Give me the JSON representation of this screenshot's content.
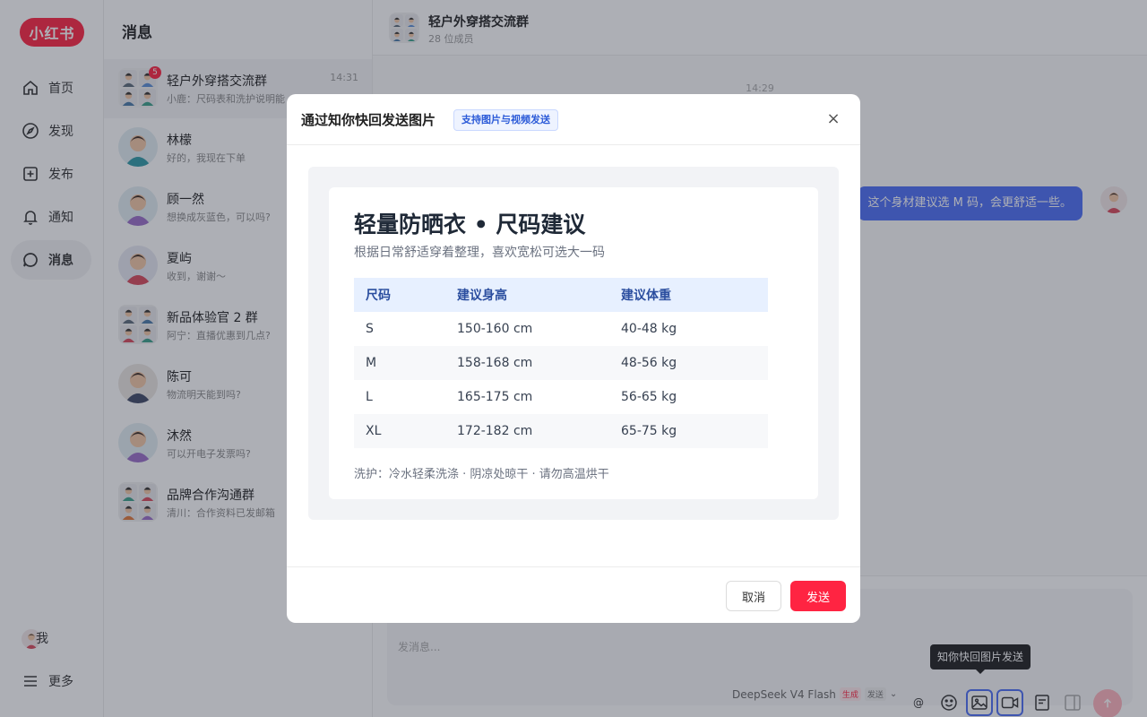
{
  "brand": {
    "logo_text": "小红书",
    "accent": "#ff2442"
  },
  "nav": {
    "items": [
      {
        "label": "首页",
        "icon": "home-icon"
      },
      {
        "label": "发现",
        "icon": "compass-icon"
      },
      {
        "label": "发布",
        "icon": "plus-square-icon"
      },
      {
        "label": "通知",
        "icon": "bell-icon"
      },
      {
        "label": "消息",
        "icon": "chat-icon",
        "active": true
      }
    ],
    "me_label": "我",
    "more_label": "更多"
  },
  "conversations": {
    "title": "消息",
    "items": [
      {
        "name": "轻户外穿搭交流群",
        "preview": "小鹿：尺码表和洗护说明能",
        "time": "14:31",
        "badge": "5",
        "group": true
      },
      {
        "name": "林檬",
        "preview": "好的，我现在下单"
      },
      {
        "name": "顾一然",
        "preview": "想换成灰蓝色，可以吗?"
      },
      {
        "name": "夏屿",
        "preview": "收到，谢谢～"
      },
      {
        "name": "新品体验官 2 群",
        "preview": "阿宁：直播优惠到几点?",
        "group": true
      },
      {
        "name": "陈可",
        "preview": "物流明天能到吗?"
      },
      {
        "name": "沐然",
        "preview": "可以开电子发票吗?"
      },
      {
        "name": "品牌合作沟通群",
        "preview": "清川：合作资料已发邮箱",
        "group": true
      }
    ]
  },
  "chat": {
    "title": "轻户外穿搭交流群",
    "member_count": "28 位成员",
    "timestamp": "14:29",
    "message": "这个身材建议选 M 码，会更舒适一些。",
    "input_placeholder": "发消息...",
    "model_name": "DeepSeek V4 Flash",
    "model_tag_gen": "生成",
    "model_tag_send": "发送",
    "at_symbol": "@",
    "tooltip": "知你快回图片发送"
  },
  "modal": {
    "title": "通过知你快回发送图片",
    "pill": "支持图片与视频发送",
    "close": "×",
    "card": {
      "title": "轻量防晒衣 • 尺码建议",
      "subtitle": "根据日常舒适穿着整理，喜欢宽松可选大一码",
      "headers": [
        "尺码",
        "建议身高",
        "建议体重"
      ],
      "rows": [
        [
          "S",
          "150-160 cm",
          "40-48 kg"
        ],
        [
          "M",
          "158-168 cm",
          "48-56 kg"
        ],
        [
          "L",
          "165-175 cm",
          "56-65 kg"
        ],
        [
          "XL",
          "172-182 cm",
          "65-75 kg"
        ]
      ],
      "care": "洗护：冷水轻柔洗涤 · 阴凉处晾干 · 请勿高温烘干"
    },
    "cancel_label": "取消",
    "send_label": "发送"
  }
}
